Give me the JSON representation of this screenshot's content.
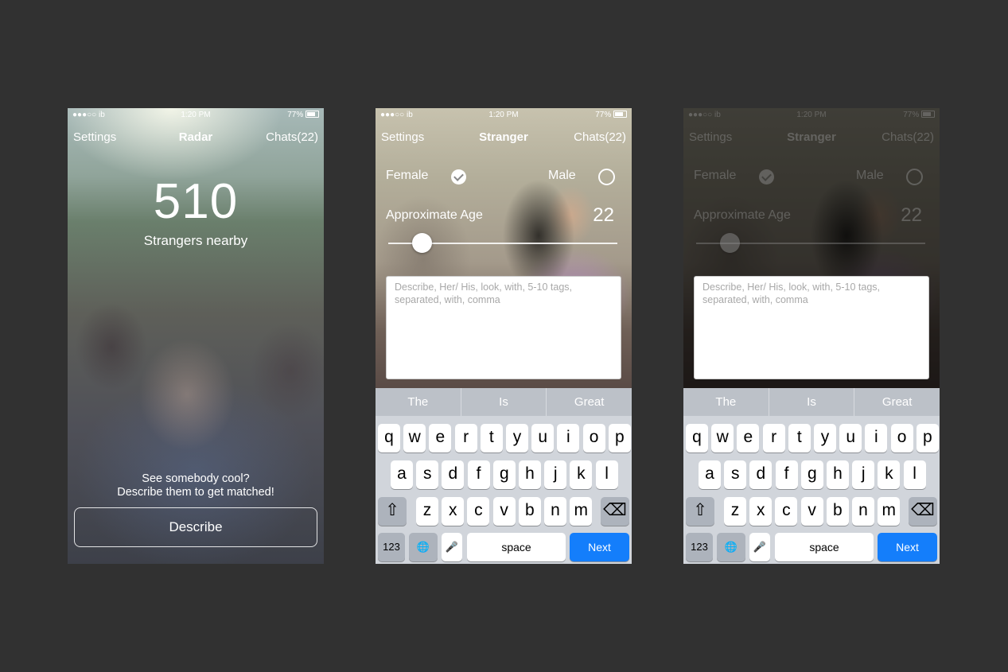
{
  "screens": [
    {
      "status": {
        "carrier": "●●●○○ ib",
        "time": "1:20 PM",
        "battery": "77%"
      },
      "nav": {
        "left": "Settings",
        "title": "Radar",
        "right": "Chats(22)"
      },
      "count": "510",
      "count_label": "Strangers nearby",
      "prompt_line1": "See somebody cool?",
      "prompt_line2": "Describe them to get matched!",
      "describe_button": "Describe"
    },
    {
      "status": {
        "carrier": "●●●○○ ib",
        "time": "1:20 PM",
        "battery": "77%"
      },
      "nav": {
        "left": "Settings",
        "title": "Stranger",
        "right": "Chats(22)"
      },
      "female_label": "Female",
      "female_selected": true,
      "male_label": "Male",
      "male_selected": false,
      "age_label": "Approximate Age",
      "age_value": "22",
      "textarea_placeholder": "Describe, Her/ His, look, with,  5-10 tags, separated, with, comma"
    },
    {
      "status": {
        "carrier": "●●●○○ ib",
        "time": "1:20 PM",
        "battery": "77%"
      },
      "nav": {
        "left": "Settings",
        "title": "Stranger",
        "right": "Chats(22)"
      },
      "female_label": "Female",
      "female_selected": true,
      "male_label": "Male",
      "male_selected": false,
      "age_label": "Approximate Age",
      "age_value": "22",
      "textarea_placeholder": "Describe, Her/ His, look, with,  5-10 tags, separated, with, comma"
    }
  ],
  "keyboard": {
    "suggestions": [
      "The",
      "Is",
      "Great"
    ],
    "row1": [
      "q",
      "w",
      "e",
      "r",
      "t",
      "y",
      "u",
      "i",
      "o",
      "p"
    ],
    "row2": [
      "a",
      "s",
      "d",
      "f",
      "g",
      "h",
      "j",
      "k",
      "l"
    ],
    "row3": [
      "z",
      "x",
      "c",
      "v",
      "b",
      "n",
      "m"
    ],
    "shift_symbol": "⇧",
    "delete_symbol": "⌫",
    "numbers_key": "123",
    "globe_symbol": "🌐",
    "mic_symbol": "🎤",
    "space_key": "space",
    "next_key": "Next"
  },
  "colors": {
    "background": "#313131",
    "keyboard_bg": "#d1d5db",
    "next_key": "#147efb"
  }
}
